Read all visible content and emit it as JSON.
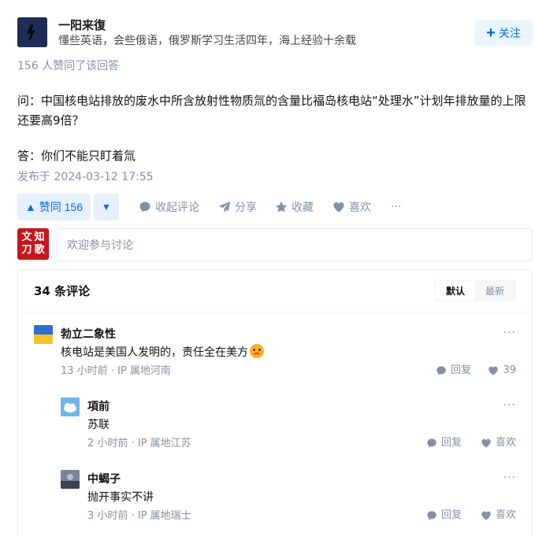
{
  "author": {
    "name": "一阳来復",
    "headline": "懂些英语，会些俄语，俄罗斯学习生活四年，海上经验十余载",
    "follow_label": "关注",
    "follow_icon": "plus-icon"
  },
  "voters_text": "156 人赞同了该回答",
  "answer": {
    "question_line": "问：中国核电站排放的废水中所含放射性物质氚的含量比福岛核电站“处理水”计划年排放量的上限还要高9倍？",
    "answer_line": "答：你们不能只盯着氚",
    "published": "发布于 2024-03-12 17:55"
  },
  "actions": {
    "vote_up_label": "▲ 赞同 156",
    "vote_down_label": "▼",
    "collapse_comments": "收起评论",
    "share": "分享",
    "favorite": "收藏",
    "like": "喜欢",
    "more": "···"
  },
  "compose": {
    "avatar_chars": [
      "文",
      "知",
      "刀",
      "歌"
    ],
    "placeholder": "欢迎参与讨论"
  },
  "comments": {
    "count_label": "34 条评论",
    "sort_default": "默认",
    "sort_latest": "最新",
    "items": [
      {
        "name": "勃立二象性",
        "text": "核电站是美国人发明的，责任全在美方",
        "time": "13 小时前",
        "ip": "IP 属地河南",
        "reply_label": "回复",
        "like_label": "39",
        "more": "···"
      },
      {
        "name": "項前",
        "text": "苏联",
        "time": "2 小时前",
        "ip": "IP 属地江苏",
        "reply_label": "回复",
        "like_label": "喜欢",
        "more": "···"
      },
      {
        "name": "中蝎子",
        "text": "抛开事实不讲",
        "time": "3 小时前",
        "ip": "IP 属地瑞士",
        "reply_label": "回复",
        "like_label": "喜欢",
        "more": "···"
      }
    ]
  },
  "colors": {
    "accent": "#056de8",
    "accent_bg": "#e6f0ff",
    "muted": "#8590a6"
  }
}
